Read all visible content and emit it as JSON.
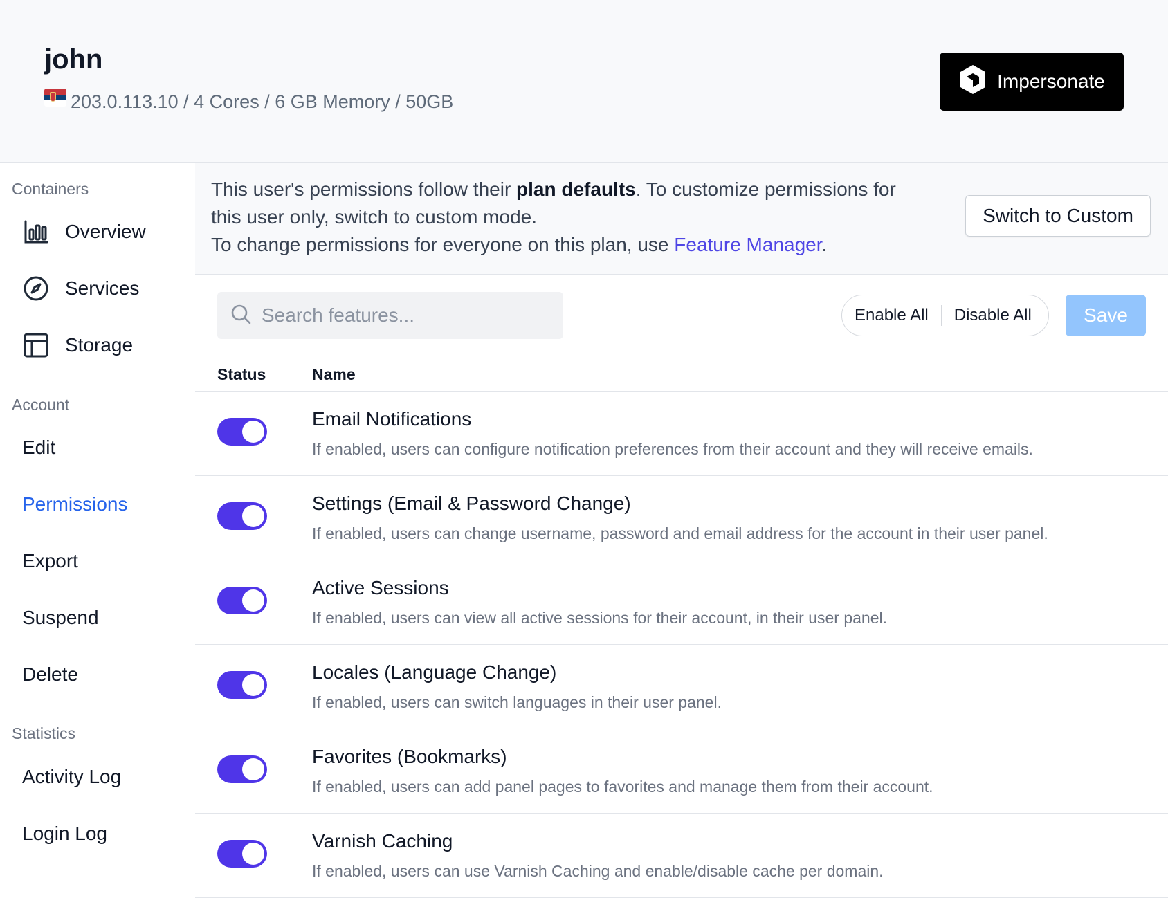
{
  "header": {
    "user_name": "john",
    "server_info": "203.0.113.10 / 4 Cores / 6 GB Memory / 50GB",
    "impersonate_label": "Impersonate"
  },
  "sidebar": {
    "sections": {
      "containers": "Containers",
      "account": "Account",
      "statistics": "Statistics"
    },
    "items": {
      "overview": "Overview",
      "services": "Services",
      "storage": "Storage",
      "edit": "Edit",
      "permissions": "Permissions",
      "export": "Export",
      "suspend": "Suspend",
      "delete": "Delete",
      "activity_log": "Activity Log",
      "login_log": "Login Log"
    },
    "active_item": "permissions"
  },
  "notice": {
    "text_prefix": "This user's permissions follow their ",
    "text_bold": "plan defaults",
    "text_suffix": ". To customize permissions for this user only, switch to custom mode.",
    "line2_prefix": "To change permissions for everyone on this plan, use ",
    "link_text": "Feature Manager",
    "line2_suffix": ".",
    "switch_button": "Switch to Custom"
  },
  "toolbar": {
    "search_placeholder": "Search features...",
    "enable_all": "Enable All",
    "disable_all": "Disable All",
    "save": "Save"
  },
  "table": {
    "columns": {
      "status": "Status",
      "name": "Name"
    },
    "rows": [
      {
        "enabled": true,
        "title": "Email Notifications",
        "desc": "If enabled, users can configure notification preferences from their account and they will receive emails."
      },
      {
        "enabled": true,
        "title": "Settings (Email & Password Change)",
        "desc": "If enabled, users can change username, password and email address for the account in their user panel."
      },
      {
        "enabled": true,
        "title": "Active Sessions",
        "desc": "If enabled, users can view all active sessions for their account, in their user panel."
      },
      {
        "enabled": true,
        "title": "Locales (Language Change)",
        "desc": "If enabled, users can switch languages in their user panel."
      },
      {
        "enabled": true,
        "title": "Favorites (Bookmarks)",
        "desc": "If enabled, users can add panel pages to favorites and manage them from their account."
      },
      {
        "enabled": true,
        "title": "Varnish Caching",
        "desc": "If enabled, users can use Varnish Caching and enable/disable cache per domain."
      }
    ]
  },
  "colors": {
    "toggle_on": "#4f35e8",
    "link": "#4f46e5",
    "active_nav": "#2563eb",
    "save_disabled": "#93c5fd"
  }
}
